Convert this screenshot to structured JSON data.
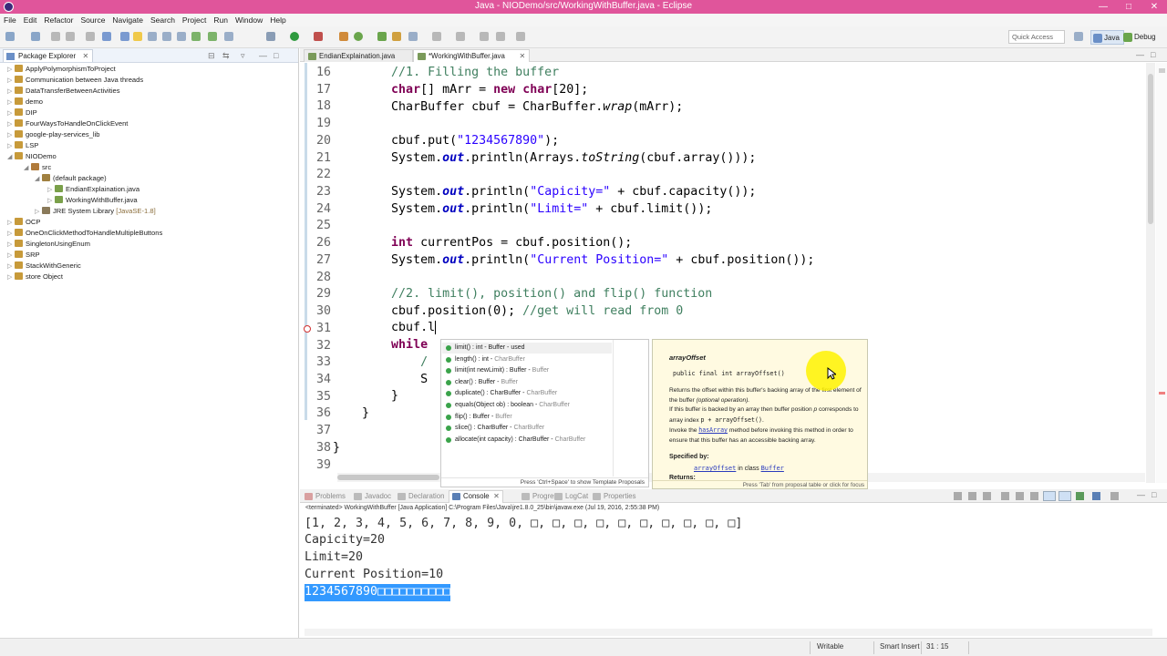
{
  "window": {
    "title": "Java - NIODemo/src/WorkingWithBuffer.java - Eclipse",
    "title_bar_color": "#e0559b"
  },
  "menu": [
    "File",
    "Edit",
    "Refactor",
    "Source",
    "Navigate",
    "Search",
    "Project",
    "Run",
    "Window",
    "Help"
  ],
  "toolbar": {
    "quick_access": "Quick Access",
    "perspectives": [
      "Java",
      "Debug"
    ]
  },
  "package_explorer": {
    "title": "Package Explorer",
    "items": [
      {
        "label": "ApplyPolymorphismToProject",
        "expanded": false
      },
      {
        "label": "Communication between Java threads",
        "expanded": false
      },
      {
        "label": "DataTransferBetweenActivities",
        "expanded": false
      },
      {
        "label": "demo",
        "expanded": false
      },
      {
        "label": "DIP",
        "expanded": false
      },
      {
        "label": "FourWaysToHandleOnClickEvent",
        "expanded": false
      },
      {
        "label": "google-play-services_lib",
        "expanded": false
      },
      {
        "label": "LSP",
        "expanded": false
      },
      {
        "label": "NIODemo",
        "expanded": true
      },
      {
        "label": "src",
        "expanded": true
      },
      {
        "label": "(default package)",
        "expanded": true
      },
      {
        "label": "EndianExplaination.java",
        "expanded": false
      },
      {
        "label": "WorkingWithBuffer.java",
        "expanded": false
      },
      {
        "label": "JRE System Library",
        "sublabel": "[JavaSE-1.8]",
        "expanded": false
      },
      {
        "label": "OCP",
        "expanded": false
      },
      {
        "label": "OneOnClickMethodToHandleMultipleButtons",
        "expanded": false
      },
      {
        "label": "SingletonUsingEnum",
        "expanded": false
      },
      {
        "label": "SRP",
        "expanded": false
      },
      {
        "label": "StackWithGeneric",
        "expanded": false
      },
      {
        "label": "store Object",
        "expanded": false
      }
    ]
  },
  "editor_tabs": [
    {
      "label": "EndianExplaination.java",
      "active": false
    },
    {
      "label": "*WorkingWithBuffer.java",
      "active": true
    }
  ],
  "editor": {
    "line_numbers": [
      "16",
      "17",
      "18",
      "19",
      "20",
      "21",
      "22",
      "23",
      "24",
      "25",
      "26",
      "27",
      "28",
      "29",
      "30",
      "31",
      "32",
      "33",
      "34",
      "35",
      "36",
      "37",
      "38",
      "39"
    ],
    "current_line": "31"
  },
  "completion": {
    "items": [
      {
        "sig": "limit() : int - Buffer - used",
        "owner": ""
      },
      {
        "sig": "length() : int - ",
        "owner": "CharBuffer"
      },
      {
        "sig": "limit(int newLimit) : Buffer - ",
        "owner": "Buffer"
      },
      {
        "sig": "clear() : Buffer - ",
        "owner": "Buffer"
      },
      {
        "sig": "duplicate() : CharBuffer - ",
        "owner": "CharBuffer"
      },
      {
        "sig": "equals(Object ob) : boolean - ",
        "owner": "CharBuffer"
      },
      {
        "sig": "flip() : Buffer - ",
        "owner": "Buffer"
      },
      {
        "sig": "slice() : CharBuffer - ",
        "owner": "CharBuffer"
      },
      {
        "sig": "allocate(int capacity) : CharBuffer - ",
        "owner": "CharBuffer"
      }
    ],
    "status": "Press 'Ctrl+Space' to show Template Proposals"
  },
  "javadoc": {
    "name": "arrayOffset",
    "signature": "public final int arrayOffset()",
    "desc1": "Returns the offset within this buffer's backing array of the first element of the buffer ",
    "desc1_it": "(optional operation).",
    "desc2": "If this buffer is backed by an array then buffer position ",
    "desc2_p": "p",
    "desc3": " corresponds to array index ",
    "desc3_expr": "p + arrayOffset()",
    "desc3_end": ".",
    "desc4": "Invoke the ",
    "desc4_link": "hasArray",
    "desc4_end": " method before invoking this method in order to ensure that this buffer has an accessible backing array.",
    "specified_by": "Specified by:",
    "spec_link1": "arrayOffset",
    "spec_mid": " in class ",
    "spec_link2": "Buffer",
    "returns": "Returns:",
    "status": "Press 'Tab' from proposal table or click for focus"
  },
  "console_tabs": [
    {
      "label": "Problems",
      "active": false
    },
    {
      "label": "Javadoc",
      "active": false
    },
    {
      "label": "Declaration",
      "active": false
    },
    {
      "label": "Console",
      "active": true
    },
    {
      "label": "Progress",
      "active": false
    },
    {
      "label": "LogCat",
      "active": false
    },
    {
      "label": "Properties",
      "active": false
    }
  ],
  "console": {
    "terminated": "<terminated> WorkingWithBuffer [Java Application] C:\\Program Files\\Java\\jre1.8.0_25\\bin\\javaw.exe (Jul 19, 2016, 2:55:38 PM)",
    "lines": [
      "[1, 2, 3, 4, 5, 6, 7, 8, 9, 0, □, □, □, □, □, □, □, □, □, □]",
      "Capicity=20",
      "Limit=20",
      "Current Position=10"
    ],
    "selected_line": "1234567890□□□□□□□□□□"
  },
  "status_bar": {
    "mode": "Writable",
    "insert": "Smart Insert",
    "position": "31 : 15"
  }
}
